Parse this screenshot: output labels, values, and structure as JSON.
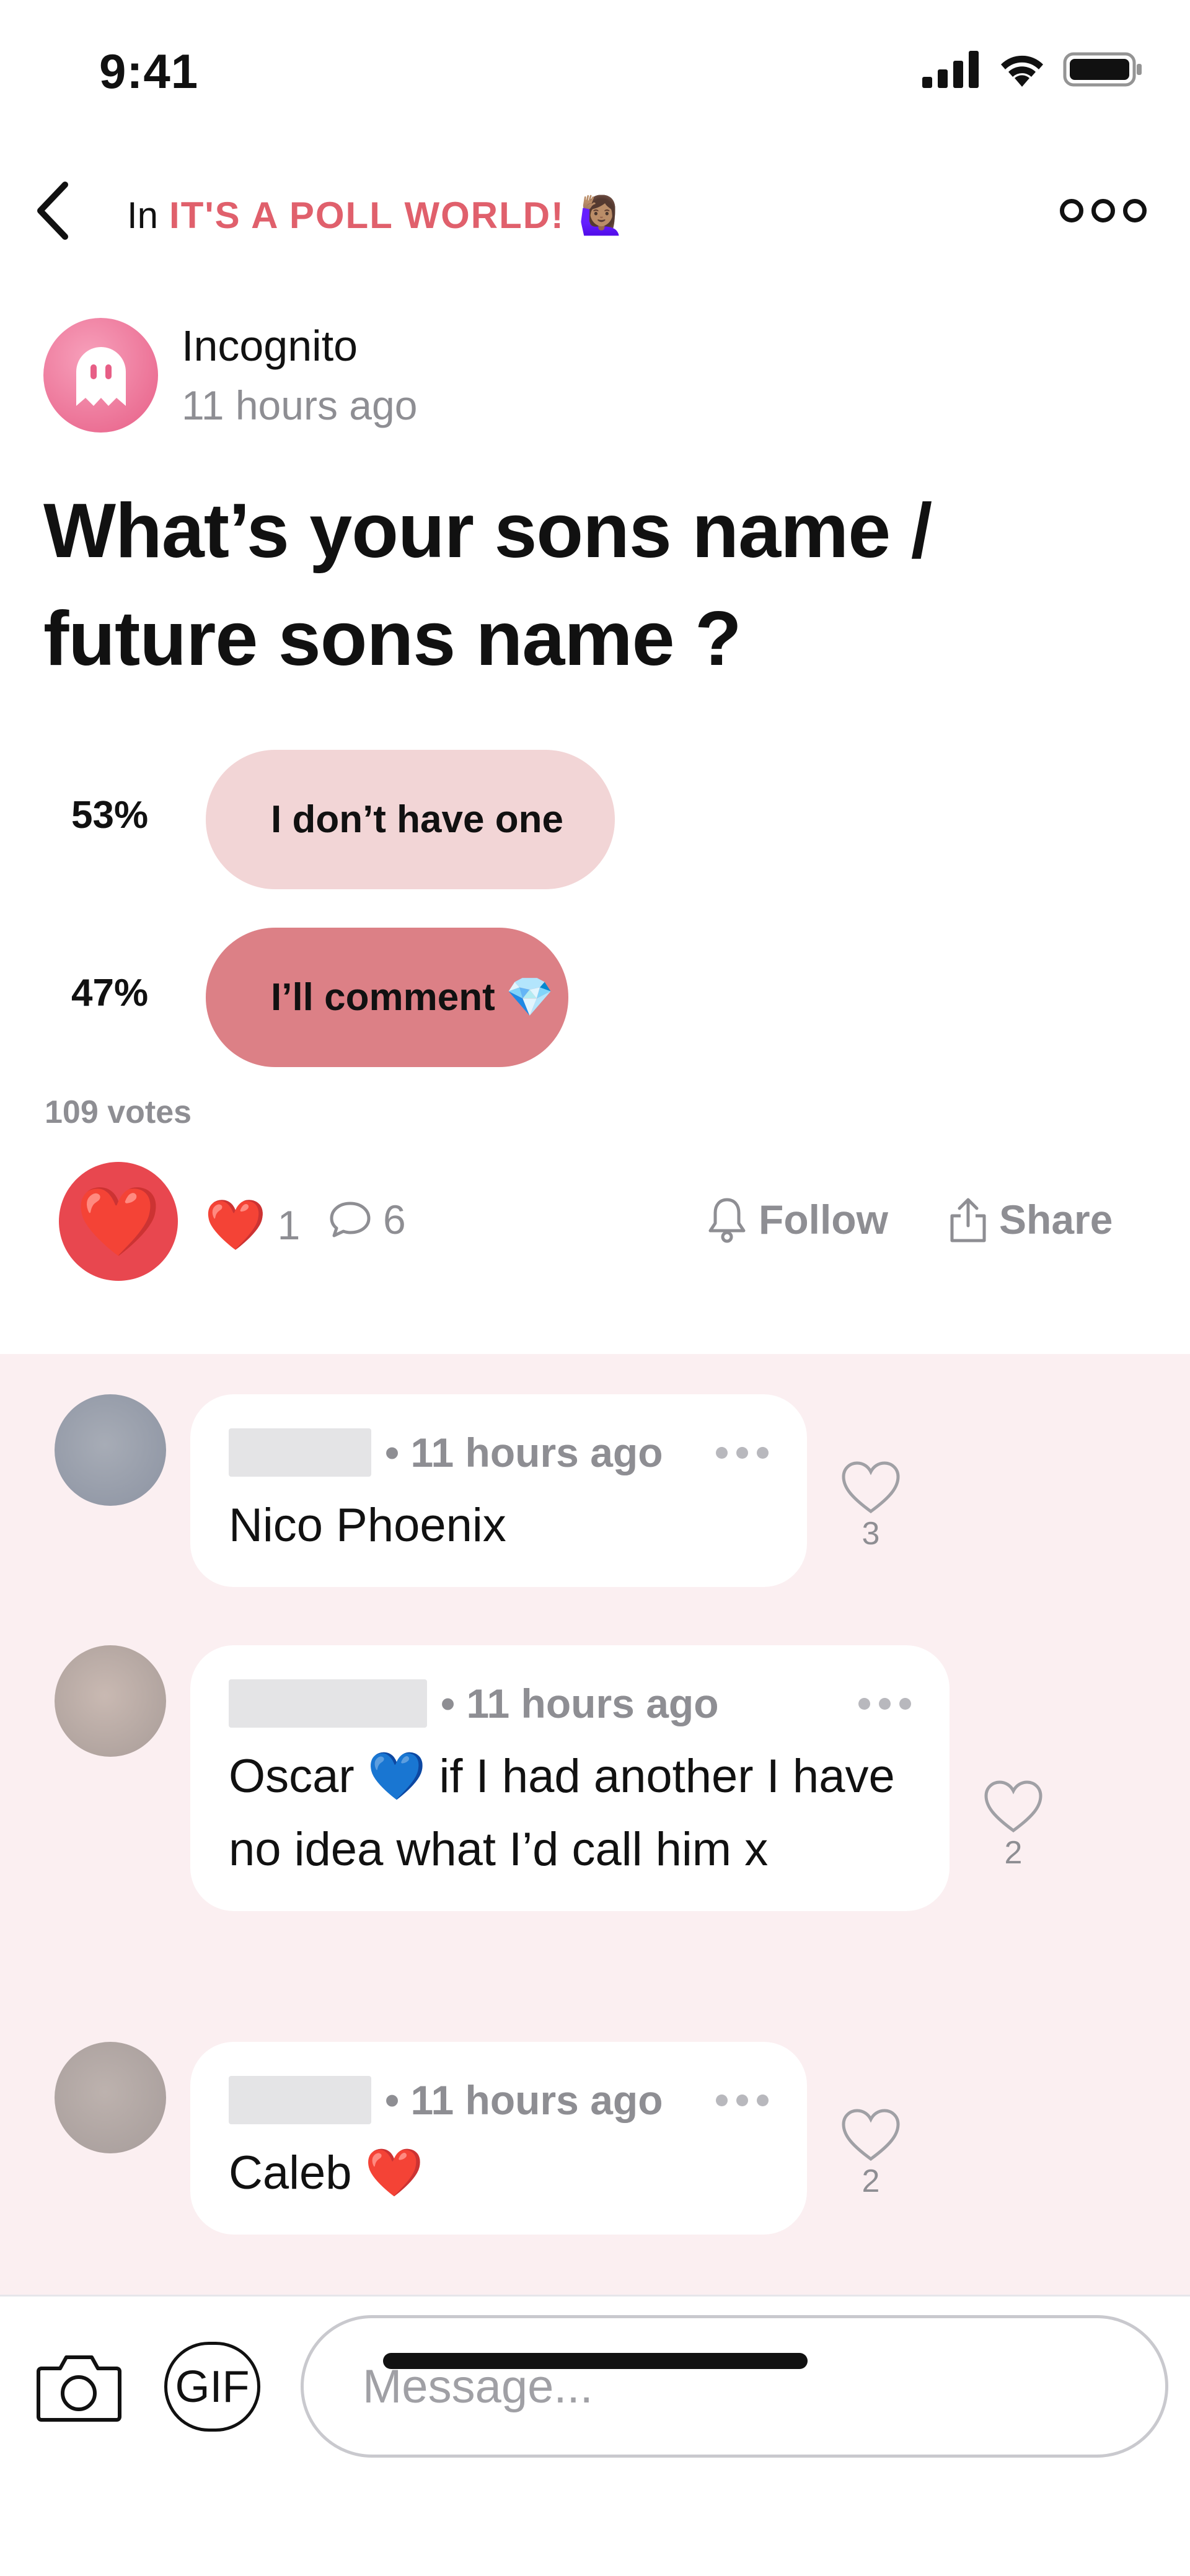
{
  "status_bar": {
    "time": "9:41"
  },
  "nav": {
    "in_label": "In",
    "community": "IT'S A POLL WORLD!",
    "community_emoji": "🙋🏽‍♀️"
  },
  "author": {
    "name": "Incognito",
    "time": "11 hours ago"
  },
  "post": {
    "title": "What’s your sons name / future sons name ?"
  },
  "poll": {
    "options": [
      {
        "percent": "53%",
        "label": "I don’t have one",
        "share": 0.53
      },
      {
        "percent": "47%",
        "label": "I’ll comment 💎",
        "share": 0.47
      }
    ],
    "votes": "109 votes"
  },
  "reactions": {
    "likes": "1",
    "comments": "6",
    "follow_label": "Follow",
    "share_label": "Share"
  },
  "comments": [
    {
      "time": "• 11 hours ago",
      "text": "Nico Phoenix",
      "likes": "3",
      "avatar_color": "#9aa0ad"
    },
    {
      "time": "• 11 hours ago",
      "text": "Oscar 💙 if I had another I have no idea what I’d call him x",
      "likes": "2",
      "avatar_color": "#bfb0aa"
    },
    {
      "time": "• 11 hours ago",
      "text": "Caleb ❤️",
      "likes": "2",
      "avatar_color": "#b3a9a6"
    }
  ],
  "composer": {
    "gif_label": "GIF",
    "placeholder": "Message..."
  },
  "colors": {
    "accent": "#e0606c",
    "poll_light": "#f2d5d6",
    "poll_dark": "#dc8086",
    "comments_bg": "#fbeff1"
  }
}
